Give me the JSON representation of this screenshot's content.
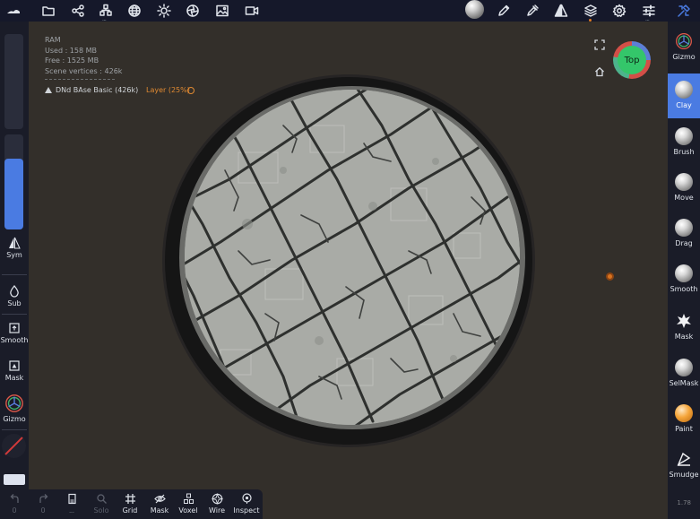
{
  "top_toolbar": {
    "icons": [
      "app-logo-icon",
      "folder-icon",
      "share-nodes-icon",
      "scene-tree-icon",
      "sphere-grid-icon",
      "sun-icon",
      "camera-film-icon",
      "image-icon",
      "video-icon",
      "matcap-sphere-icon",
      "pen-icon",
      "dropper-icon",
      "symmetry-icon",
      "layers-icon",
      "settings-icon",
      "sliders-icon",
      "help-tools-icon"
    ]
  },
  "stats": {
    "ram_label": "RAM",
    "used": "Used : 158 MB",
    "free": "Free : 1525 MB",
    "vertices": "Scene vertices : 426k"
  },
  "mesh": {
    "name": "DNd BAse Basic (426k)",
    "layer": "Layer (25%)"
  },
  "view_cube": {
    "label": "Top"
  },
  "left_panel": {
    "sym": "Sym",
    "sub": "Sub",
    "smooth": "Smooth",
    "mask": "Mask",
    "gizmo": "Gizmo",
    "radius_fraction": 0.15,
    "intensity_fraction": 0.75
  },
  "right_tools": [
    {
      "label": "Gizmo",
      "active": false
    },
    {
      "label": "Clay",
      "active": true
    },
    {
      "label": "Brush",
      "active": false
    },
    {
      "label": "Move",
      "active": false
    },
    {
      "label": "Drag",
      "active": false
    },
    {
      "label": "Smooth",
      "active": false
    },
    {
      "label": "Mask",
      "active": false
    },
    {
      "label": "SelMask",
      "active": false
    },
    {
      "label": "Paint",
      "active": false
    },
    {
      "label": "Smudge",
      "active": false
    }
  ],
  "bottom_bar": {
    "undo": "0",
    "redo": "0",
    "tools": [
      "Solo",
      "Grid",
      "Mask",
      "Voxel",
      "Wire",
      "Inspect"
    ]
  },
  "version": "1.78",
  "colors": {
    "accent": "#4a7be2",
    "panel": "#1a1c28",
    "viewport": "#332f2a",
    "orange": "#e08a32",
    "view_green": "#34c66a"
  }
}
